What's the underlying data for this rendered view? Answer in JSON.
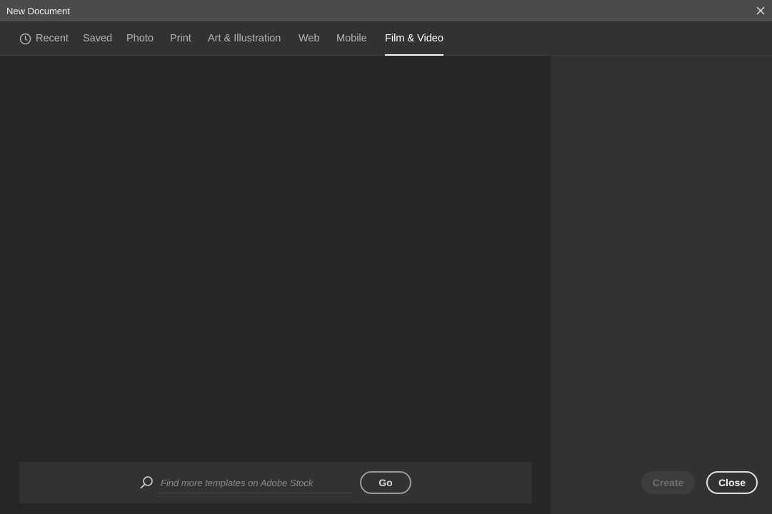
{
  "window": {
    "title": "New Document"
  },
  "tabs": [
    {
      "label": "Recent",
      "icon": "clock-icon"
    },
    {
      "label": "Saved"
    },
    {
      "label": "Photo"
    },
    {
      "label": "Print"
    },
    {
      "label": "Art & Illustration"
    },
    {
      "label": "Web"
    },
    {
      "label": "Mobile"
    },
    {
      "label": "Film & Video",
      "active": true
    }
  ],
  "search": {
    "placeholder": "Find more templates on Adobe Stock",
    "value": "",
    "go_label": "Go"
  },
  "footer": {
    "create_label": "Create",
    "close_label": "Close"
  },
  "colors": {
    "titlebar": "#4b4b4b",
    "tabbar": "#323232",
    "left_pane": "#262626",
    "right_pane": "#323232",
    "active_tab": "#ffffff"
  }
}
